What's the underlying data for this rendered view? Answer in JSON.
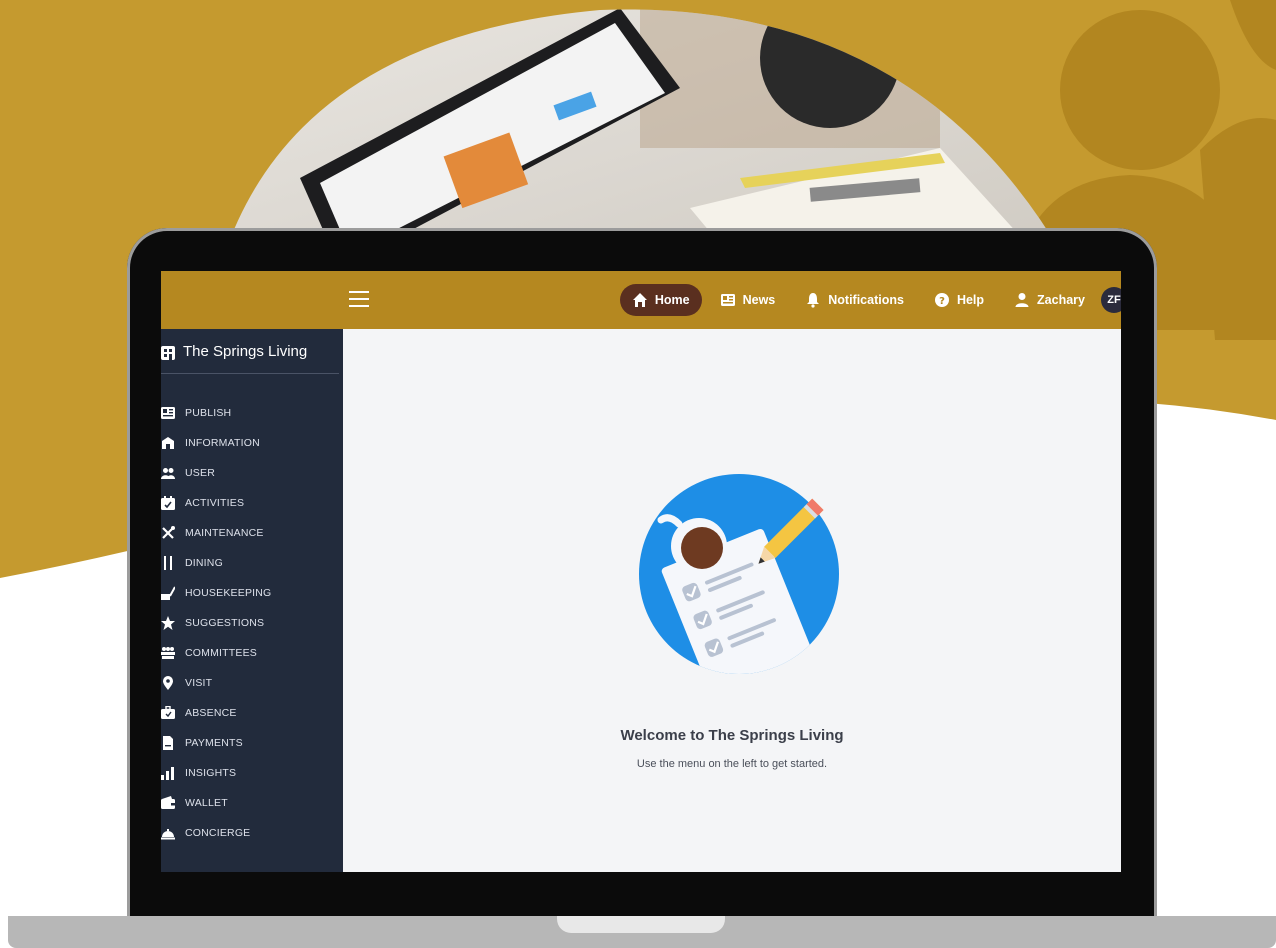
{
  "colors": {
    "brand_gold": "#c59a2f",
    "topbar": "#b58820",
    "active_tab": "#5a2f1f",
    "sidebar": "#222b3c",
    "content_bg": "#f4f5f7",
    "illustration_blue": "#1e8ee6"
  },
  "topbar": {
    "menu_icon": "hamburger-icon",
    "nav": [
      {
        "label": "Home",
        "icon": "home-icon",
        "active": true
      },
      {
        "label": "News",
        "icon": "newspaper-icon",
        "active": false
      },
      {
        "label": "Notifications",
        "icon": "bell-icon",
        "active": false
      },
      {
        "label": "Help",
        "icon": "question-circle-icon",
        "active": false
      },
      {
        "label": "Zachary",
        "icon": "user-icon",
        "active": false
      }
    ],
    "avatar_initials": "ZF"
  },
  "sidebar": {
    "org_name": "The Springs Living",
    "items": [
      {
        "label": "PUBLISH",
        "icon": "newspaper-icon"
      },
      {
        "label": "INFORMATION",
        "icon": "building-icon"
      },
      {
        "label": "USER",
        "icon": "users-icon"
      },
      {
        "label": "ACTIVITIES",
        "icon": "calendar-icon"
      },
      {
        "label": "MAINTENANCE",
        "icon": "tools-icon"
      },
      {
        "label": "DINING",
        "icon": "utensils-icon"
      },
      {
        "label": "HOUSEKEEPING",
        "icon": "broom-icon"
      },
      {
        "label": "SUGGESTIONS",
        "icon": "star-icon"
      },
      {
        "label": "COMMITTEES",
        "icon": "group-icon"
      },
      {
        "label": "VISIT",
        "icon": "map-pin-icon"
      },
      {
        "label": "ABSENCE",
        "icon": "suitcase-icon"
      },
      {
        "label": "PAYMENTS",
        "icon": "document-icon"
      },
      {
        "label": "INSIGHTS",
        "icon": "bar-chart-icon"
      },
      {
        "label": "WALLET",
        "icon": "wallet-icon"
      },
      {
        "label": "CONCIERGE",
        "icon": "bell-service-icon"
      }
    ]
  },
  "main": {
    "welcome_title": "Welcome to The Springs Living",
    "welcome_subtitle": "Use the menu on the left to get started."
  }
}
